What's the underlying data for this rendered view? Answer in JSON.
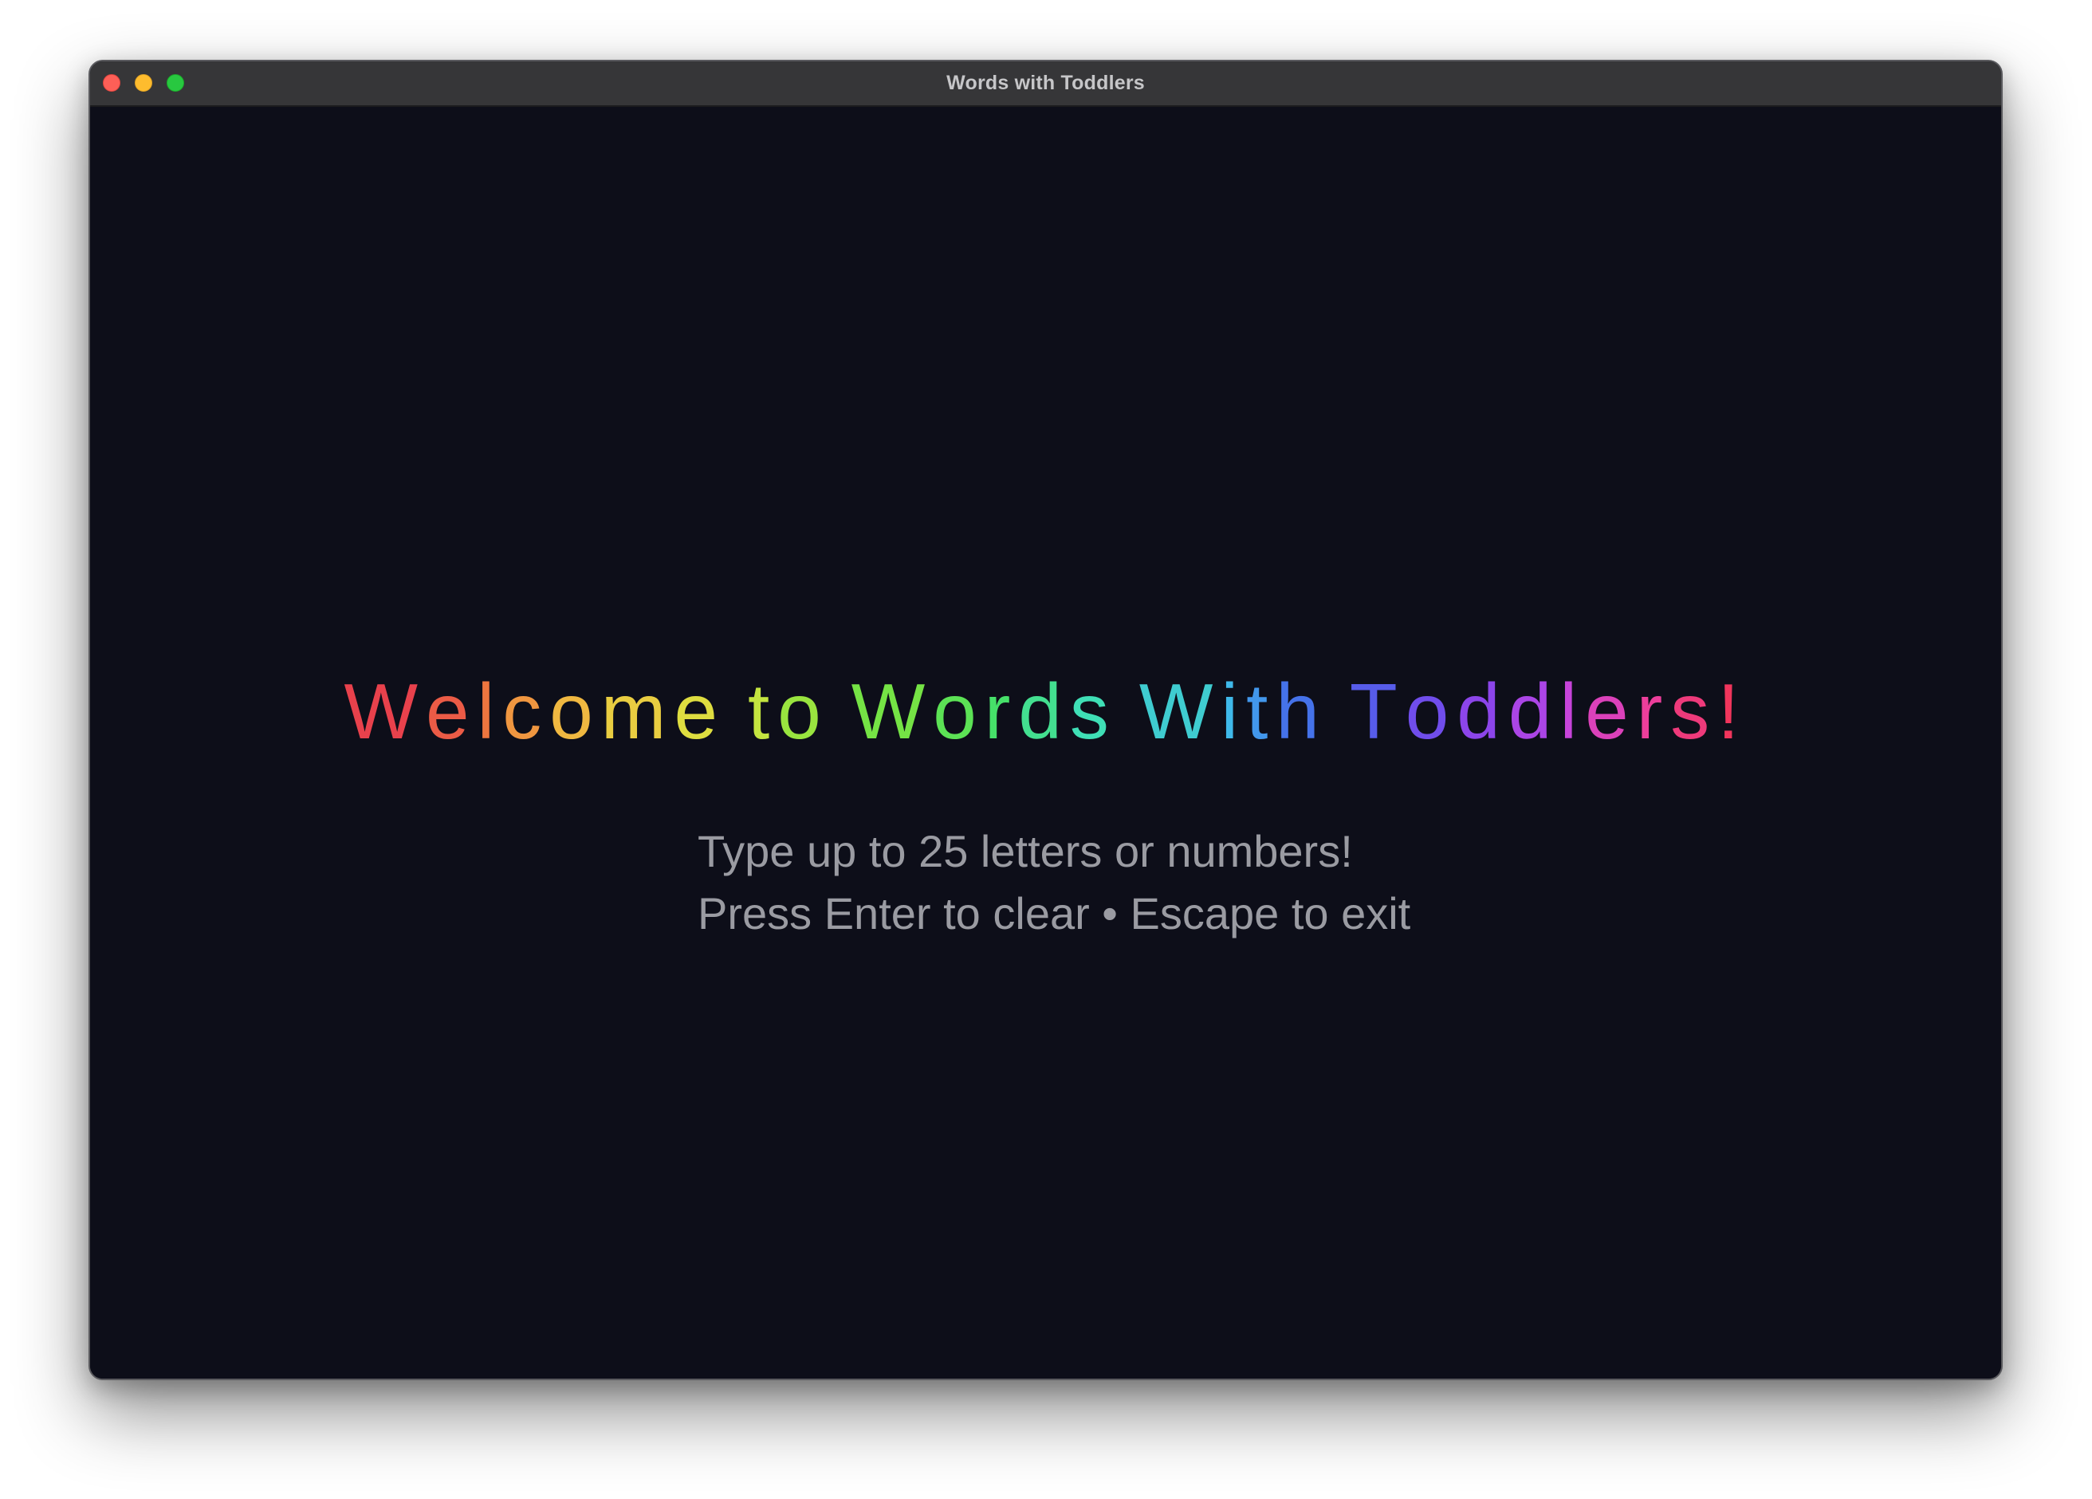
{
  "window": {
    "title": "Words with Toddlers",
    "controls": {
      "close_color": "#fe5f57",
      "minimize_color": "#febc2e",
      "maximize_color": "#28c840"
    }
  },
  "welcome": {
    "text": "Welcome to Words With Toddlers!",
    "gradient_colors": [
      "#e8414c",
      "#ee7a3e",
      "#f0c342",
      "#d9e540",
      "#7de43f",
      "#47e063",
      "#3fdfb6",
      "#3fb6ee",
      "#4666e8",
      "#7c45ec",
      "#c045e4",
      "#ec3fa0",
      "#f0355c"
    ]
  },
  "instructions": {
    "line1": "Type up to 25 letters or numbers!",
    "line2": "Press Enter to clear • Escape to exit"
  }
}
